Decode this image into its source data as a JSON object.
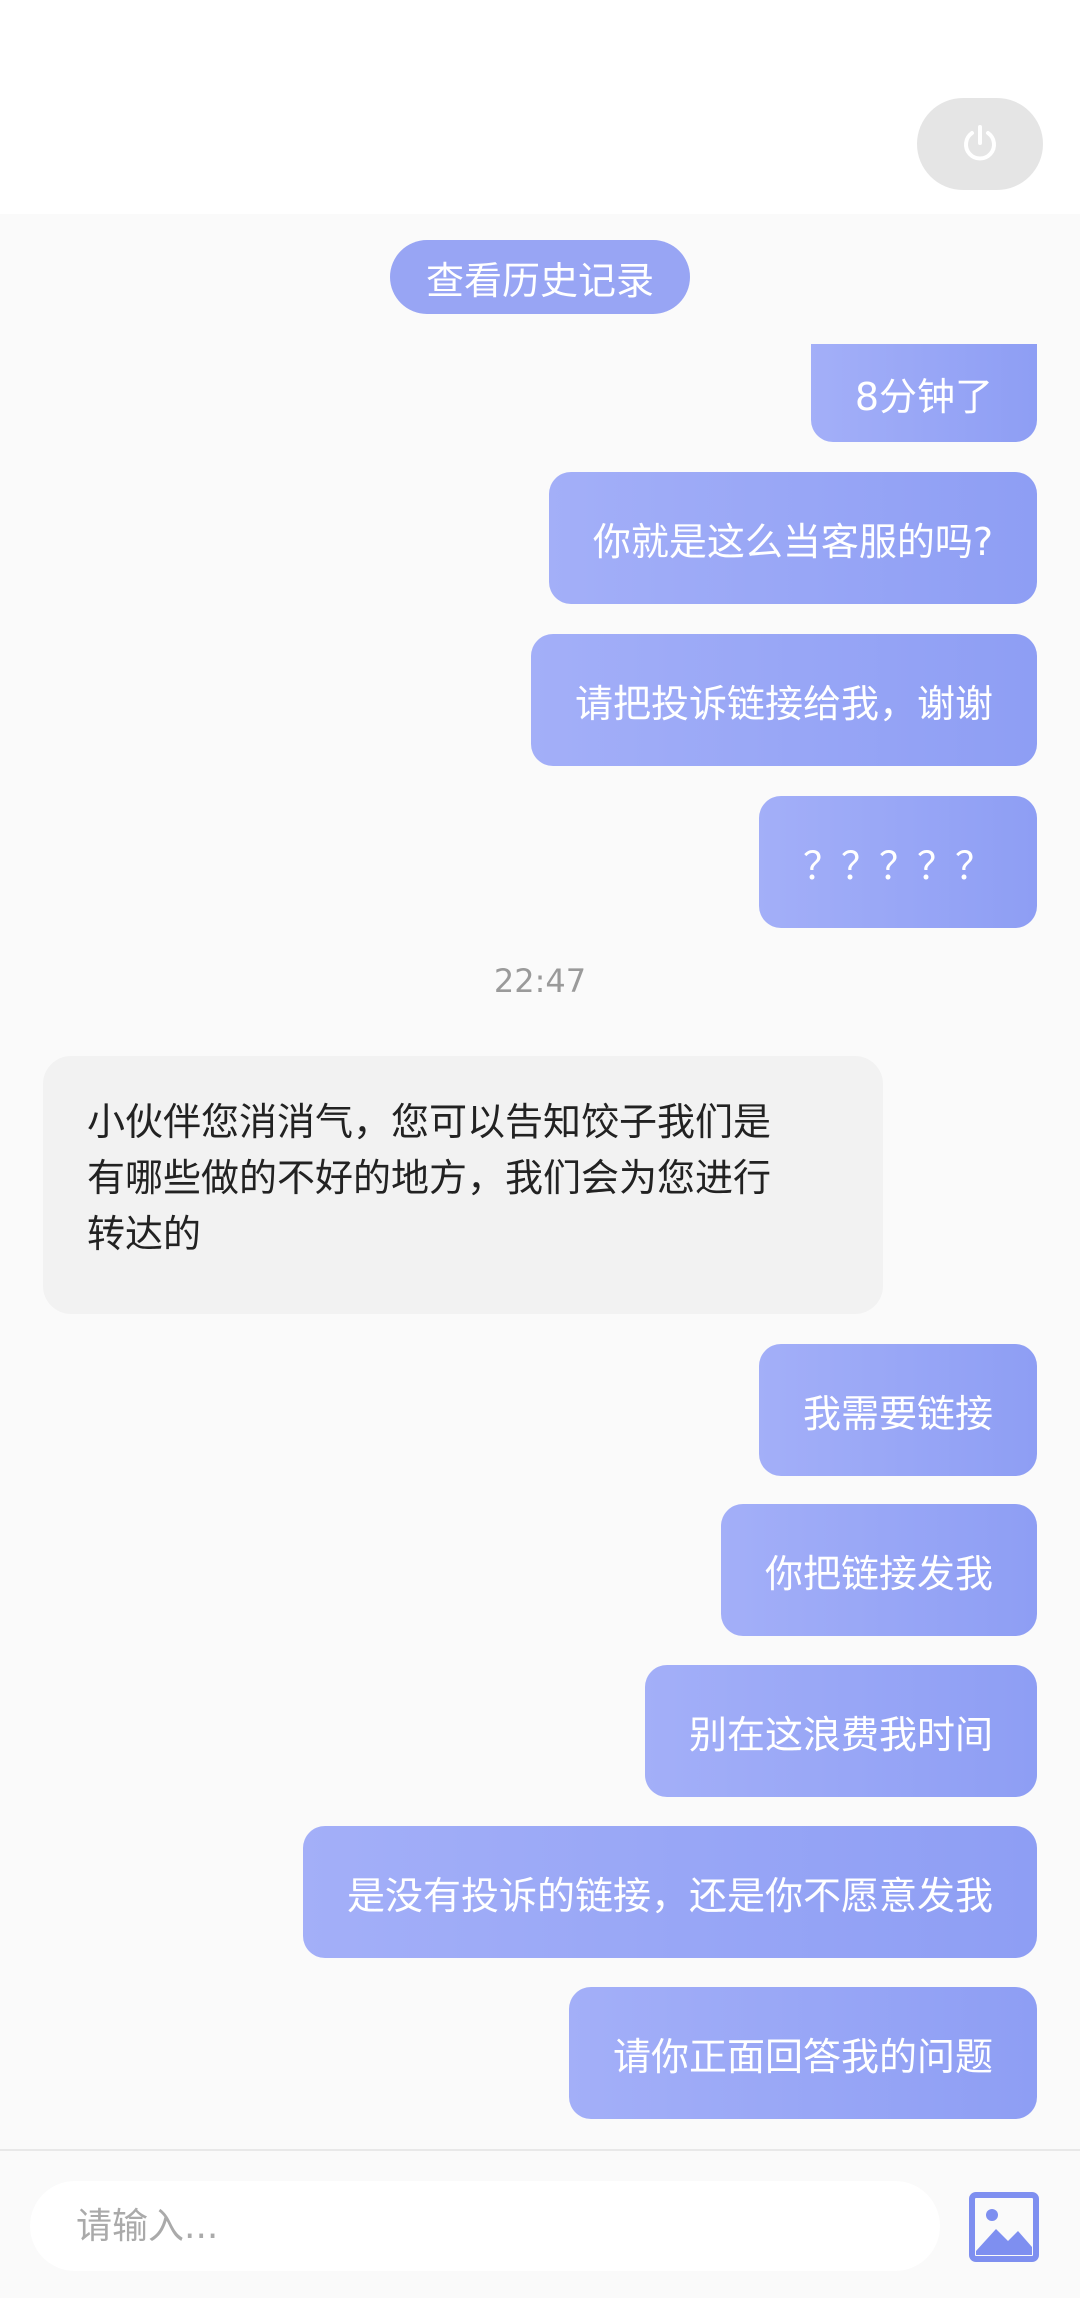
{
  "header": {
    "power_icon": "power-icon"
  },
  "chat": {
    "history_button_label": "查看历史记录",
    "timestamp": "22:47",
    "messages": [
      {
        "side": "out",
        "text": "8分钟了"
      },
      {
        "side": "out",
        "text": "你就是这么当客服的吗?"
      },
      {
        "side": "out",
        "text": "请把投诉链接给我，谢谢"
      },
      {
        "side": "out",
        "text": "？？？？？"
      },
      {
        "side": "in",
        "lines": [
          "小伙伴您消消气，您可以告知饺子我们是",
          "有哪些做的不好的地方，我们会为您进行",
          "转达的"
        ]
      },
      {
        "side": "out",
        "text": "我需要链接"
      },
      {
        "side": "out",
        "text": "你把链接发我"
      },
      {
        "side": "out",
        "text": "别在这浪费我时间"
      },
      {
        "side": "out",
        "text": "是没有投诉的链接，还是你不愿意发我"
      },
      {
        "side": "out",
        "text": "请你正面回答我的问题"
      }
    ]
  },
  "input": {
    "placeholder": "请输入...",
    "value": "",
    "image_icon": "image-icon"
  },
  "colors": {
    "bubble_out_start": "#a3aff8",
    "bubble_out_end": "#8e9ef4",
    "bubble_in": "#f2f2f2",
    "pill": "#98a5f4",
    "icon_blue": "#7e8ff0"
  }
}
